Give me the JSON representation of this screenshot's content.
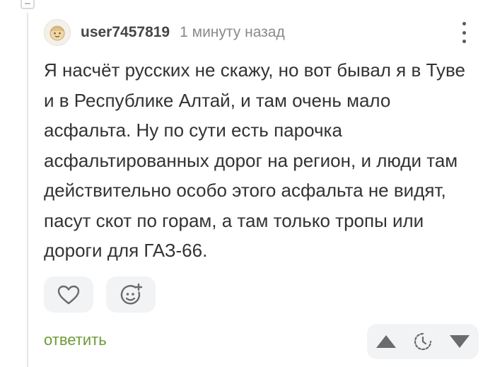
{
  "comment": {
    "username": "user7457819",
    "timestamp": "1 минуту назад",
    "text": "Я насчёт русских не скажу, но вот бывал я в Туве и в Республике Алтай, и там очень мало асфальта. Ну по сути есть парочка асфальтированных дорог на регион, и люди там действительно особо этого асфальта не видят, пасут скот по горам, а там только тропы или дороги для ГАЗ-66."
  },
  "actions": {
    "reply_label": "ответить"
  },
  "icons": {
    "avatar": "avatar-face-icon",
    "menu": "more-vertical-icon",
    "like": "heart-icon",
    "emoji": "add-reaction-icon",
    "upvote": "upvote-arrow-icon",
    "rating": "rating-hidden-clock-icon",
    "downvote": "downvote-arrow-icon"
  },
  "colors": {
    "reply": "#6f9a39",
    "icon": "#6b6b6b",
    "button_bg": "#f2f3f5"
  }
}
